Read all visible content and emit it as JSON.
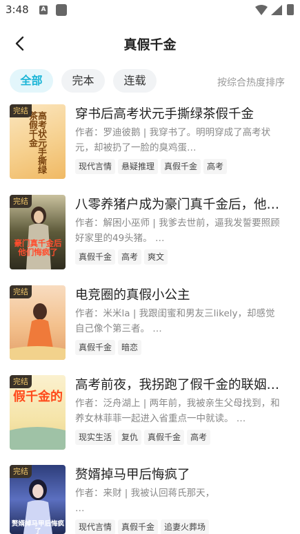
{
  "status_bar": {
    "time": "3:48",
    "notif_icon_letter": "A"
  },
  "header": {
    "title": "真假千金"
  },
  "filters": {
    "chips": [
      {
        "label": "全部",
        "active": true
      },
      {
        "label": "完本",
        "active": false
      },
      {
        "label": "连载",
        "active": false
      }
    ],
    "sort_label": "按综合热度排序"
  },
  "books": [
    {
      "badge": "完结",
      "title": "穿书后高考状元手撕绿茶假千金",
      "desc": "作者：罗迪彼鹅 | 我穿书了。明明穿成了高考状元，却被扔了一脸的臭鸡蛋…",
      "tags": [
        "现代言情",
        "悬疑推理",
        "真假千金",
        "高考"
      ],
      "cover_text": "高考状元手撕绿茶假千金"
    },
    {
      "badge": "完结",
      "title": "八零养猪户成为豪门真千金后，他…",
      "desc": "作者：解困小巫师 | 我爹去世前，逼我发誓要照顾好家里的49头猪。 …",
      "tags": [
        "真假千金",
        "高考",
        "爽文"
      ],
      "cover_text": "豪门真千金后他们悔疯了"
    },
    {
      "badge": "完结",
      "title": "电竞圈的真假小公主",
      "desc": "作者：米米la | 我跟闺蜜和男友三likely，却感觉自己像个第三者。 …",
      "tags": [
        "真假千金",
        "暗恋"
      ],
      "cover_text": ""
    },
    {
      "badge": "完结",
      "title": "高考前夜，我拐跑了假千金的联姻…",
      "desc": "作者：泛舟湖上 | 两年前，我被亲生父母找到，和养女林菲菲一起进入省重点一中就读。 …",
      "tags": [
        "现实生活",
        "复仇",
        "真假千金",
        "高考"
      ],
      "cover_text": "假千金的"
    },
    {
      "badge": "完结",
      "title": "赘婿掉马甲后悔疯了",
      "desc": "作者：来财 | 我被认回蒋氏那天，\n…",
      "tags": [
        "现代言情",
        "真假千金",
        "追妻火葬场"
      ],
      "cover_text": "赘婿掉马甲后悔疯了"
    }
  ],
  "colors": {
    "accent": "#19b4d6",
    "chip_bg": "#f1f3f5",
    "badge_bg": "#3a3229",
    "badge_text": "#f0c66a"
  }
}
